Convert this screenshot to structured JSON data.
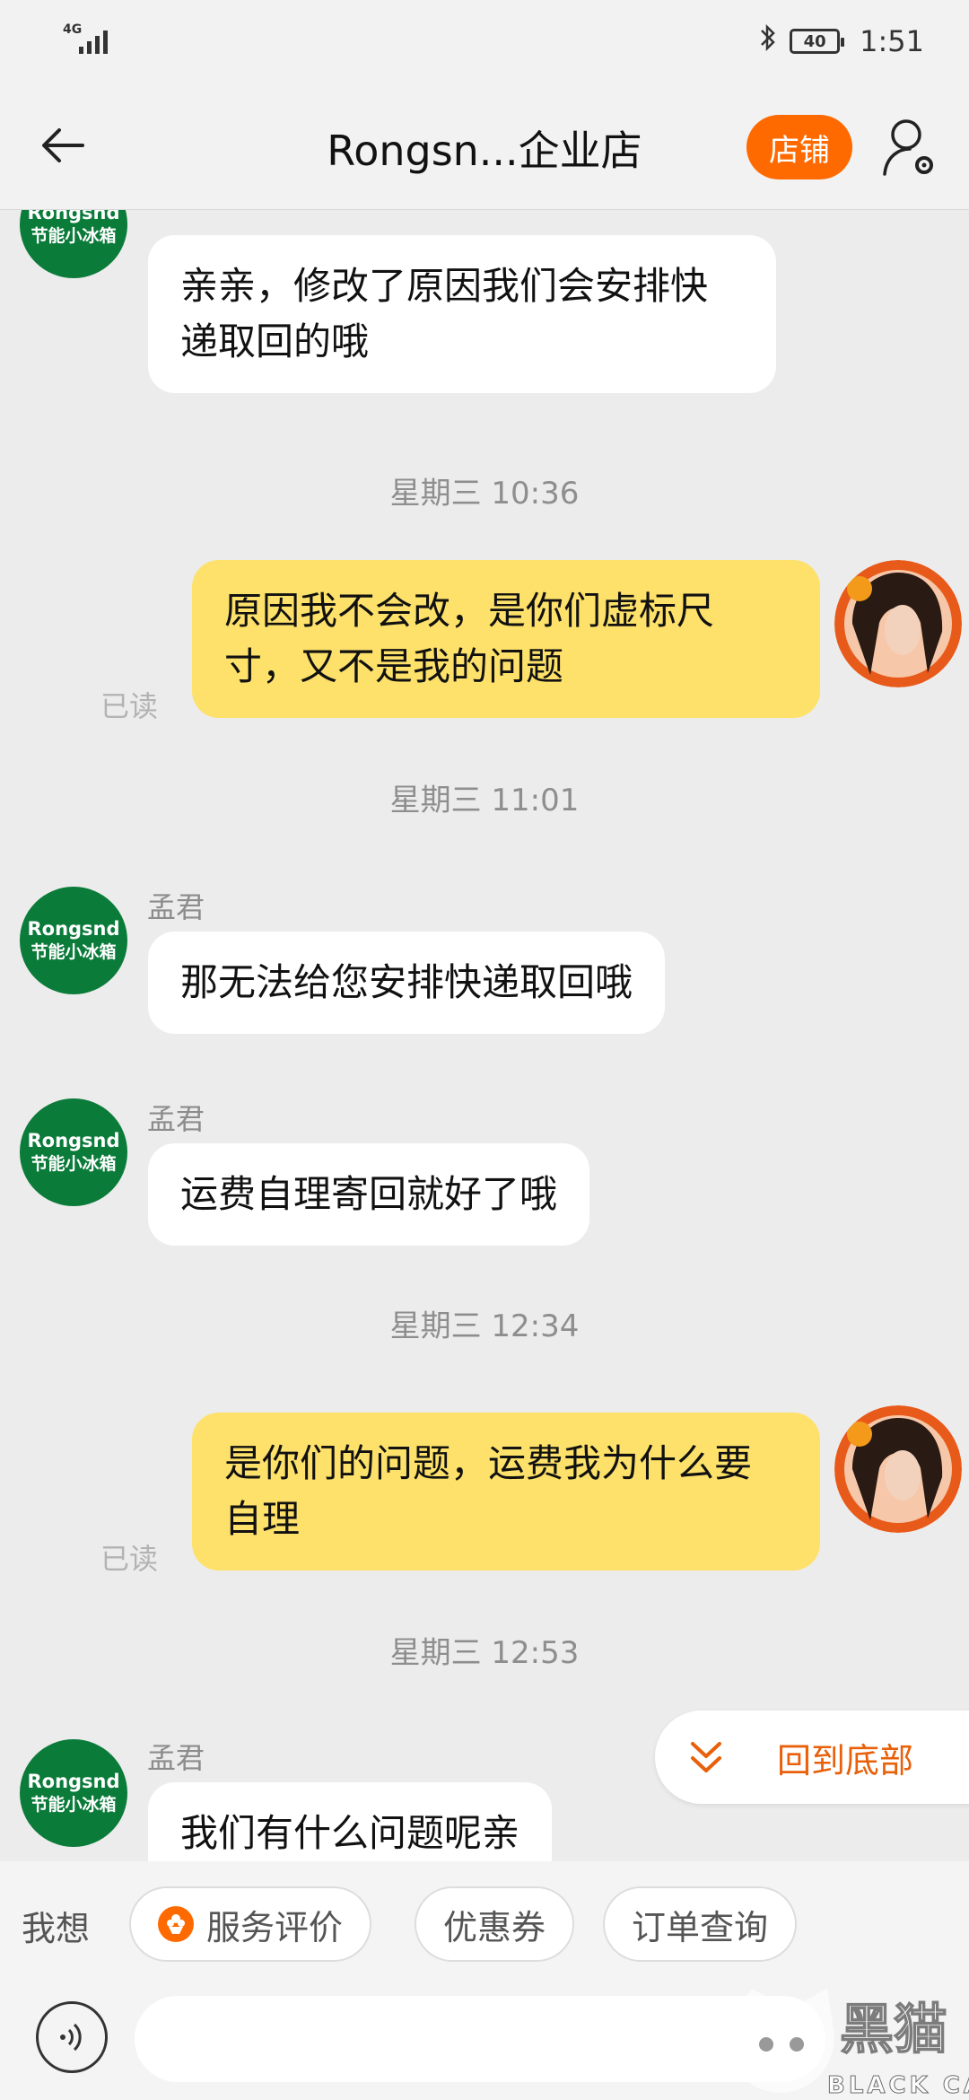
{
  "status_bar": {
    "network": "4G",
    "battery": "40",
    "time": "1:51"
  },
  "header": {
    "title": "Rongsn...企业店",
    "shop_button": "店铺"
  },
  "shop_avatar": {
    "line1": "Rongsnd",
    "line2": "节能小冰箱"
  },
  "messages": [
    {
      "type": "in",
      "text": "亲亲，修改了原因我们会安排快递取回的哦"
    },
    {
      "type": "time",
      "text": "星期三 10:36"
    },
    {
      "type": "out",
      "text": "原因我不会改，是你们虚标尺寸，又不是我的问题",
      "status": "已读"
    },
    {
      "type": "time",
      "text": "星期三 11:01"
    },
    {
      "type": "in",
      "sender": "孟君",
      "text": "那无法给您安排快递取回哦"
    },
    {
      "type": "in",
      "sender": "孟君",
      "text": "运费自理寄回就好了哦"
    },
    {
      "type": "time",
      "text": "星期三 12:34"
    },
    {
      "type": "out",
      "text": "是你们的问题，运费我为什么要自理",
      "status": "已读"
    },
    {
      "type": "time",
      "text": "星期三 12:53"
    },
    {
      "type": "in",
      "sender": "孟君",
      "text": "我们有什么问题呢亲"
    }
  ],
  "scroll_to_bottom": "回到底部",
  "quick_bar": {
    "label": "我想",
    "chips": [
      "服务评价",
      "优惠券",
      "订单查询"
    ]
  },
  "input": {
    "value": "",
    "placeholder": ""
  },
  "watermark": {
    "text": "黑猫",
    "subtext": "BLACK CAT"
  },
  "colors": {
    "accent": "#ff6a00",
    "outgoing_bubble": "#fde16a",
    "shop_avatar": "#0b7b3a"
  }
}
